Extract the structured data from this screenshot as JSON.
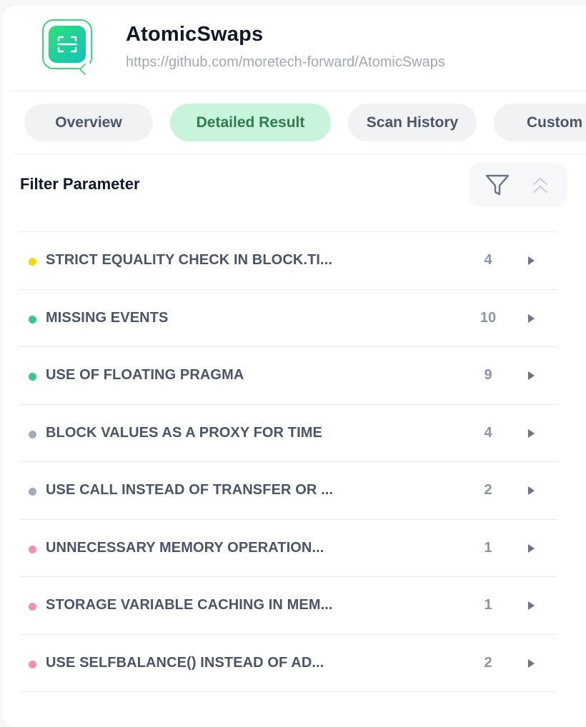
{
  "project": {
    "name": "AtomicSwaps",
    "url": "https://github.com/moretech-forward/AtomicSwaps",
    "logo_icon": "scan-icon",
    "accent": "#2fe07c"
  },
  "tabs": [
    {
      "label": "Overview",
      "active": false
    },
    {
      "label": "Detailed Result",
      "active": true
    },
    {
      "label": "Scan History",
      "active": false
    },
    {
      "label": "Custom",
      "active": false
    }
  ],
  "filter": {
    "title": "Filter Parameter",
    "filter_icon": "funnel-icon",
    "collapse_icon": "chevrons-up-icon"
  },
  "issues": [
    {
      "label": "STRICT EQUALITY CHECK IN BLOCK.TI...",
      "count": "4",
      "color": "#f5d90a"
    },
    {
      "label": "MISSING EVENTS",
      "count": "10",
      "color": "#38c98a"
    },
    {
      "label": "USE OF FLOATING PRAGMA",
      "count": "9",
      "color": "#38c98a"
    },
    {
      "label": "BLOCK VALUES AS A PROXY FOR TIME",
      "count": "4",
      "color": "#a3acbd"
    },
    {
      "label": "USE CALL INSTEAD OF TRANSFER OR ...",
      "count": "2",
      "color": "#a3acbd"
    },
    {
      "label": "UNNECESSARY MEMORY OPERATION...",
      "count": "1",
      "color": "#f291ad"
    },
    {
      "label": "STORAGE VARIABLE CACHING IN MEM...",
      "count": "1",
      "color": "#f291ad"
    },
    {
      "label": "USE SELFBALANCE() INSTEAD OF AD...",
      "count": "2",
      "color": "#f291ad"
    }
  ]
}
